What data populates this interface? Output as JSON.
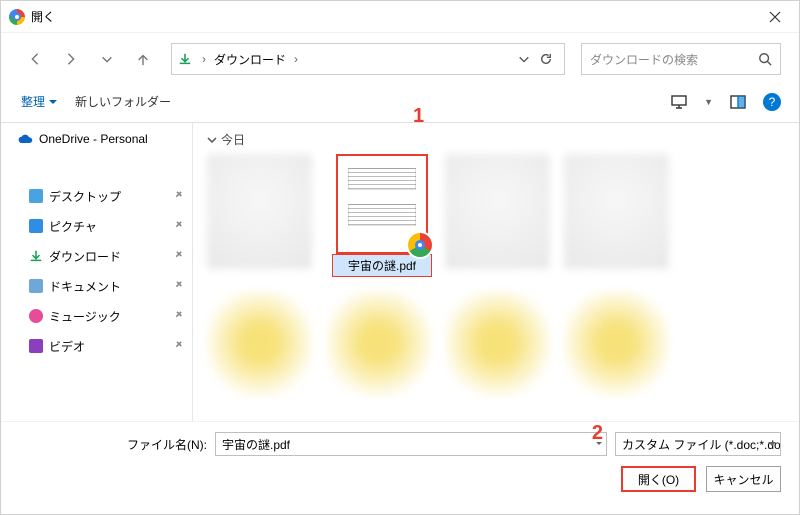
{
  "titlebar": {
    "title": "開く"
  },
  "nav": {
    "path_segment": "ダウンロード",
    "search_placeholder": "ダウンロードの検索"
  },
  "toolbar": {
    "organize": "整理",
    "new_folder": "新しいフォルダー",
    "help": "?"
  },
  "sidebar": {
    "onedrive": "OneDrive - Personal",
    "items": [
      {
        "label": "デスクトップ",
        "icon": "desktop-icon",
        "color": "#4aa3e0"
      },
      {
        "label": "ピクチャ",
        "icon": "pictures-icon",
        "color": "#2f8de4"
      },
      {
        "label": "ダウンロード",
        "icon": "downloads-icon",
        "color": "#18a058"
      },
      {
        "label": "ドキュメント",
        "icon": "documents-icon",
        "color": "#6fa8d8"
      },
      {
        "label": "ミュージック",
        "icon": "music-icon",
        "color": "#e84b9a"
      },
      {
        "label": "ビデオ",
        "icon": "videos-icon",
        "color": "#8b3fbf"
      }
    ]
  },
  "content": {
    "section_header": "今日",
    "selected_file": "宇宙の謎.pdf"
  },
  "markers": {
    "one": "1",
    "two": "2"
  },
  "footer": {
    "filename_label": "ファイル名(N):",
    "filename_value": "宇宙の謎.pdf",
    "filter": "カスタム ファイル (*.doc;*.docx;*.xls",
    "open_btn": "開く(O)",
    "cancel_btn": "キャンセル"
  }
}
